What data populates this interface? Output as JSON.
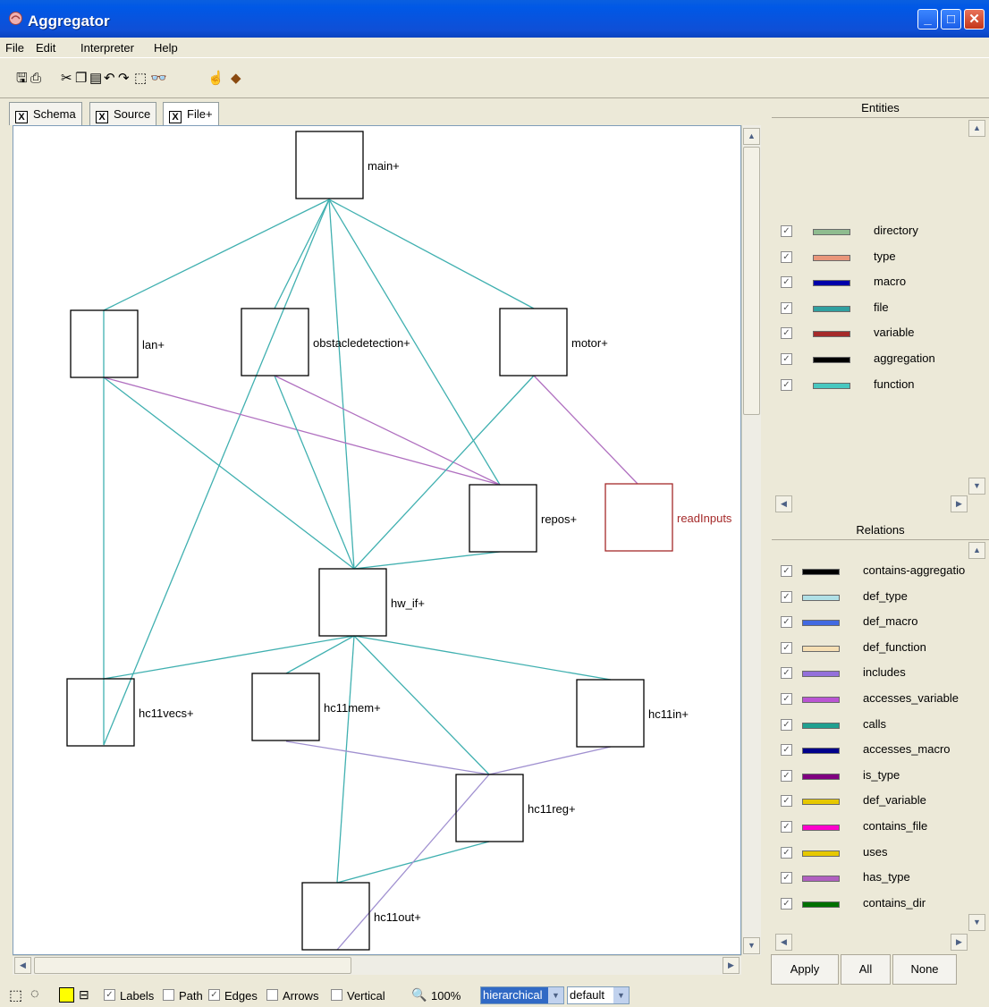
{
  "window": {
    "title": "Aggregator"
  },
  "menu": [
    "File",
    "Edit",
    "Interpreter",
    "Help"
  ],
  "tabs": [
    "Schema",
    "Source",
    "File+"
  ],
  "graph": {
    "nodes": [
      {
        "id": "main",
        "label": "main+",
        "color": "#000000"
      },
      {
        "id": "lan",
        "label": "lan+",
        "color": "#000000"
      },
      {
        "id": "obstacledetection",
        "label": "obstacledetection+",
        "color": "#000000"
      },
      {
        "id": "motor",
        "label": "motor+",
        "color": "#000000"
      },
      {
        "id": "repos",
        "label": "repos+",
        "color": "#000000"
      },
      {
        "id": "readInputs",
        "label": "readInputs",
        "color": "#a52a2a"
      },
      {
        "id": "hw_if",
        "label": "hw_if+",
        "color": "#000000"
      },
      {
        "id": "hc11vecs",
        "label": "hc11vecs+",
        "color": "#000000"
      },
      {
        "id": "hc11mem",
        "label": "hc11mem+",
        "color": "#000000"
      },
      {
        "id": "hc11in",
        "label": "hc11in+",
        "color": "#000000"
      },
      {
        "id": "hc11reg",
        "label": "hc11reg+",
        "color": "#000000"
      },
      {
        "id": "hc11out",
        "label": "hc11out+",
        "color": "#000000"
      }
    ],
    "edges": [
      {
        "from": "main",
        "to": "lan",
        "color": "#40b0b0"
      },
      {
        "from": "main",
        "to": "obstacledetection",
        "color": "#40b0b0"
      },
      {
        "from": "main",
        "to": "motor",
        "color": "#40b0b0"
      },
      {
        "from": "main",
        "to": "hw_if",
        "color": "#40b0b0"
      },
      {
        "from": "main",
        "to": "repos",
        "color": "#40b0b0"
      },
      {
        "from": "main",
        "to": "hc11vecs",
        "color": "#40b0b0"
      },
      {
        "from": "lan",
        "to": "hc11vecs",
        "color": "#40b0b0"
      },
      {
        "from": "lan",
        "to": "hw_if",
        "color": "#40b0b0"
      },
      {
        "from": "lan",
        "to": "repos",
        "color": "#b070c0"
      },
      {
        "from": "obstacledetection",
        "to": "hw_if",
        "color": "#40b0b0"
      },
      {
        "from": "obstacledetection",
        "to": "repos",
        "color": "#b070c0"
      },
      {
        "from": "motor",
        "to": "hw_if",
        "color": "#40b0b0"
      },
      {
        "from": "motor",
        "to": "readInputs",
        "color": "#b070c0"
      },
      {
        "from": "repos",
        "to": "hw_if",
        "color": "#40b0b0"
      },
      {
        "from": "hw_if",
        "to": "hc11vecs",
        "color": "#40b0b0"
      },
      {
        "from": "hw_if",
        "to": "hc11mem",
        "color": "#40b0b0"
      },
      {
        "from": "hw_if",
        "to": "hc11in",
        "color": "#40b0b0"
      },
      {
        "from": "hw_if",
        "to": "hc11reg",
        "color": "#40b0b0"
      },
      {
        "from": "hw_if",
        "to": "hc11out",
        "color": "#40b0b0"
      },
      {
        "from": "hc11mem",
        "to": "hc11reg",
        "color": "#a090d0"
      },
      {
        "from": "hc11in",
        "to": "hc11reg",
        "color": "#a090d0"
      },
      {
        "from": "hc11reg",
        "to": "hc11out",
        "color": "#40b0b0"
      },
      {
        "from": "hc11reg",
        "to": "hc11out_bottom",
        "color": "#a090d0"
      }
    ]
  },
  "entities": {
    "title": "Entities",
    "items": [
      {
        "label": "directory",
        "color": "#8fbc8f"
      },
      {
        "label": "type",
        "color": "#e9967a"
      },
      {
        "label": "macro",
        "color": "#0000aa"
      },
      {
        "label": "file",
        "color": "#30a0a0"
      },
      {
        "label": "variable",
        "color": "#a52a2a"
      },
      {
        "label": "aggregation",
        "color": "#000000"
      },
      {
        "label": "function",
        "color": "#48c8c0"
      }
    ]
  },
  "relations": {
    "title": "Relations",
    "items": [
      {
        "label": "contains-aggregatio",
        "color": "#000000"
      },
      {
        "label": "def_type",
        "color": "#b0e0e6"
      },
      {
        "label": "def_macro",
        "color": "#4169e1"
      },
      {
        "label": "def_function",
        "color": "#f5deb3"
      },
      {
        "label": "includes",
        "color": "#9370db"
      },
      {
        "label": "accesses_variable",
        "color": "#ba55d3"
      },
      {
        "label": "calls",
        "color": "#20a090"
      },
      {
        "label": "accesses_macro",
        "color": "#00008b"
      },
      {
        "label": "is_type",
        "color": "#800080"
      },
      {
        "label": "def_variable",
        "color": "#e6c800"
      },
      {
        "label": "contains_file",
        "color": "#ff00cc"
      },
      {
        "label": "uses",
        "color": "#e6c800"
      },
      {
        "label": "has_type",
        "color": "#b060c0"
      },
      {
        "label": "contains_dir",
        "color": "#007000"
      }
    ]
  },
  "buttons": {
    "apply": "Apply",
    "all": "All",
    "none": "None"
  },
  "status": {
    "labels": "Labels",
    "labels_checked": true,
    "path": "Path",
    "path_checked": false,
    "edges": "Edges",
    "edges_checked": true,
    "arrows": "Arrows",
    "arrows_checked": false,
    "vertical": "Vertical",
    "vertical_checked": false,
    "zoom": "100%",
    "layout": "hierarchical",
    "scheme": "default"
  }
}
